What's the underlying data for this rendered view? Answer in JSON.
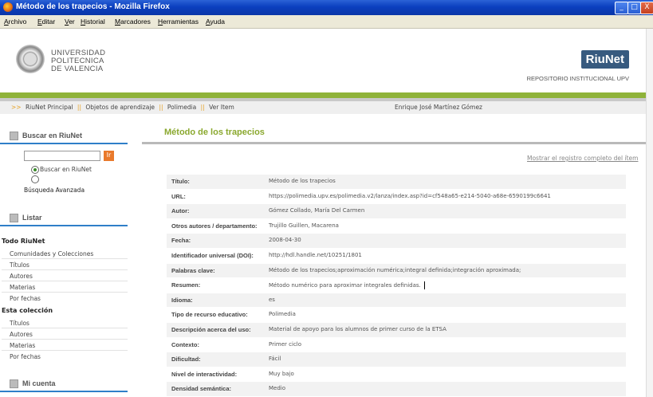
{
  "window": {
    "title": "Método de los trapecios - Mozilla Firefox",
    "minimize": "_",
    "maximize": "□",
    "close": "X"
  },
  "menu": [
    "Archivo",
    "Editar",
    "Ver",
    "Historial",
    "Marcadores",
    "Herramientas",
    "Ayuda"
  ],
  "header": {
    "university": [
      "UNIVERSIDAD",
      "POLITECNICA",
      "DE VALENCIA"
    ],
    "logo": "RiuNet",
    "repository": "REPOSITORIO INSTITUCIONAL UPV"
  },
  "breadcrumb": {
    "arrow": ">>",
    "items": [
      "RiuNet Principal",
      "Objetos de aprendizaje",
      "Polimedia",
      "Ver Item"
    ],
    "user": "Enrique José Martínez Gómez"
  },
  "sidebar": {
    "search_title": "Buscar en RiuNet",
    "search_button": "Ir",
    "radio_riunet": "Buscar en RiuNet",
    "advanced": "Búsqueda Avanzada",
    "browse_title": "Listar",
    "all_title": "Todo RiuNet",
    "all_items": [
      "Comunidades y Colecciones",
      "Títulos",
      "Autores",
      "Materias",
      "Por fechas"
    ],
    "collection_title": "Esta colección",
    "collection_items": [
      "Títulos",
      "Autores",
      "Materias",
      "Por fechas"
    ],
    "account_title": "Mi cuenta"
  },
  "main": {
    "title": "Método de los trapecios",
    "full_record_link": "Mostrar el registro completo del ítem",
    "metadata": [
      {
        "key": "Título:",
        "value": "Método de los trapecios"
      },
      {
        "key": "URL:",
        "value": "https://polimedia.upv.es/polimedia.v2/lanza/index.asp?id=cf548a65-e214-5040-a68e-6590199c6641"
      },
      {
        "key": "Autor:",
        "value": "Gómez Collado, María Del Carmen"
      },
      {
        "key": "Otros autores / departamento:",
        "value": "Trujillo Guillen, Macarena"
      },
      {
        "key": "Fecha:",
        "value": "2008-04-30"
      },
      {
        "key": "Identificador universal (DOI):",
        "value": "http://hdl.handle.net/10251/1801"
      },
      {
        "key": "Palabras clave:",
        "value": "Método de los trapecios;aproximación numérica;integral definida;integración aproximada;"
      },
      {
        "key": "Resumen:",
        "value": "Método numérico para aproximar integrales definidas."
      },
      {
        "key": "Idioma:",
        "value": "es"
      },
      {
        "key": "Tipo de recurso educativo:",
        "value": "Polimedia"
      },
      {
        "key": "Descripción acerca del uso:",
        "value": "Material de apoyo para los alumnos de primer curso de la ETSA"
      },
      {
        "key": "Contexto:",
        "value": "Primer ciclo"
      },
      {
        "key": "Dificultad:",
        "value": "Fácil"
      },
      {
        "key": "Nivel de interactividad:",
        "value": "Muy bajo"
      },
      {
        "key": "Densidad semántica:",
        "value": "Medio"
      }
    ]
  }
}
